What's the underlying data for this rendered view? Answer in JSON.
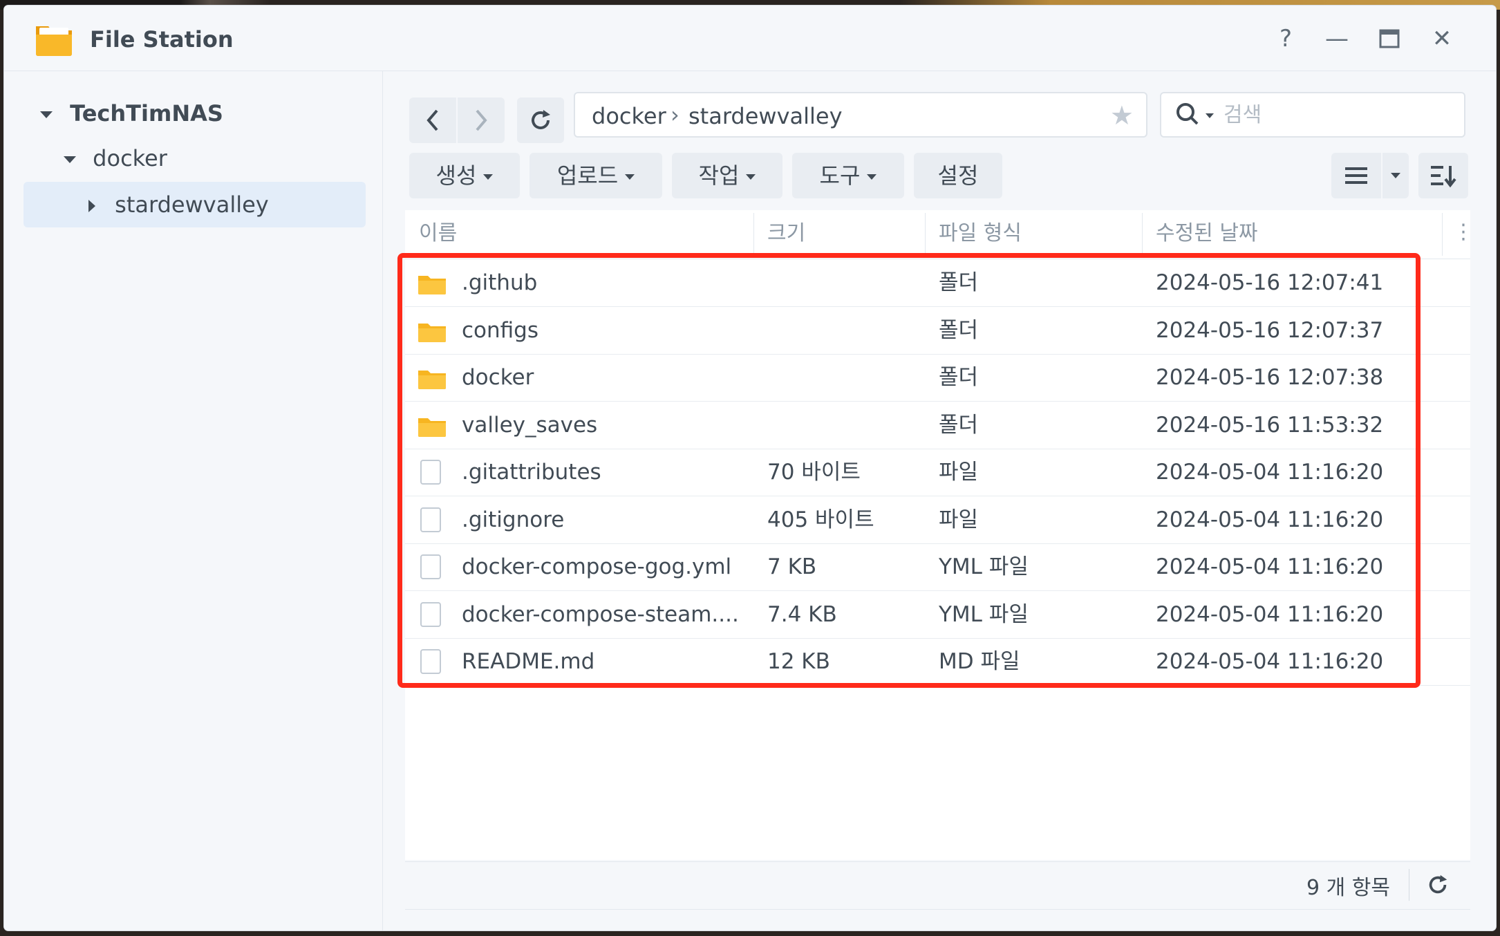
{
  "window": {
    "title": "File Station",
    "help_symbol": "?",
    "minimize_symbol": "—",
    "maximize_symbol": "▭",
    "close_symbol": "✕"
  },
  "sidebar": {
    "root": "TechTimNAS",
    "folder": "docker",
    "subfolder": "stardewvalley"
  },
  "toolbar": {
    "path": [
      "docker",
      "stardewvalley"
    ],
    "search_placeholder": "검색",
    "buttons": [
      "생성",
      "업로드",
      "작업",
      "도구",
      "설정"
    ]
  },
  "table": {
    "columns": [
      "이름",
      "크기",
      "파일 형식",
      "수정된 날짜"
    ],
    "rows": [
      {
        "name": ".github",
        "size": "",
        "type": "폴더",
        "modified": "2024-05-16 12:07:41",
        "icon": "folder-icon"
      },
      {
        "name": "configs",
        "size": "",
        "type": "폴더",
        "modified": "2024-05-16 12:07:37",
        "icon": "folder-icon"
      },
      {
        "name": "docker",
        "size": "",
        "type": "폴더",
        "modified": "2024-05-16 12:07:38",
        "icon": "folder-icon"
      },
      {
        "name": "valley_saves",
        "size": "",
        "type": "폴더",
        "modified": "2024-05-16 11:53:32",
        "icon": "folder-icon"
      },
      {
        "name": ".gitattributes",
        "size": "70 바이트",
        "type": "파일",
        "modified": "2024-05-04 11:16:20",
        "icon": "file-icon"
      },
      {
        "name": ".gitignore",
        "size": "405 바이트",
        "type": "파일",
        "modified": "2024-05-04 11:16:20",
        "icon": "file-icon"
      },
      {
        "name": "docker-compose-gog.yml",
        "size": "7 KB",
        "type": "YML 파일",
        "modified": "2024-05-04 11:16:20",
        "icon": "file-icon"
      },
      {
        "name": "docker-compose-steam....",
        "size": "7.4 KB",
        "type": "YML 파일",
        "modified": "2024-05-04 11:16:20",
        "icon": "file-icon"
      },
      {
        "name": "README.md",
        "size": "12 KB",
        "type": "MD 파일",
        "modified": "2024-05-04 11:16:20",
        "icon": "file-icon"
      }
    ]
  },
  "footer": {
    "count": "9 개 항목"
  },
  "colors": {
    "highlight": "#ff2a1a",
    "folder": "#f7b521",
    "selected_bg": "#e3edf9"
  }
}
